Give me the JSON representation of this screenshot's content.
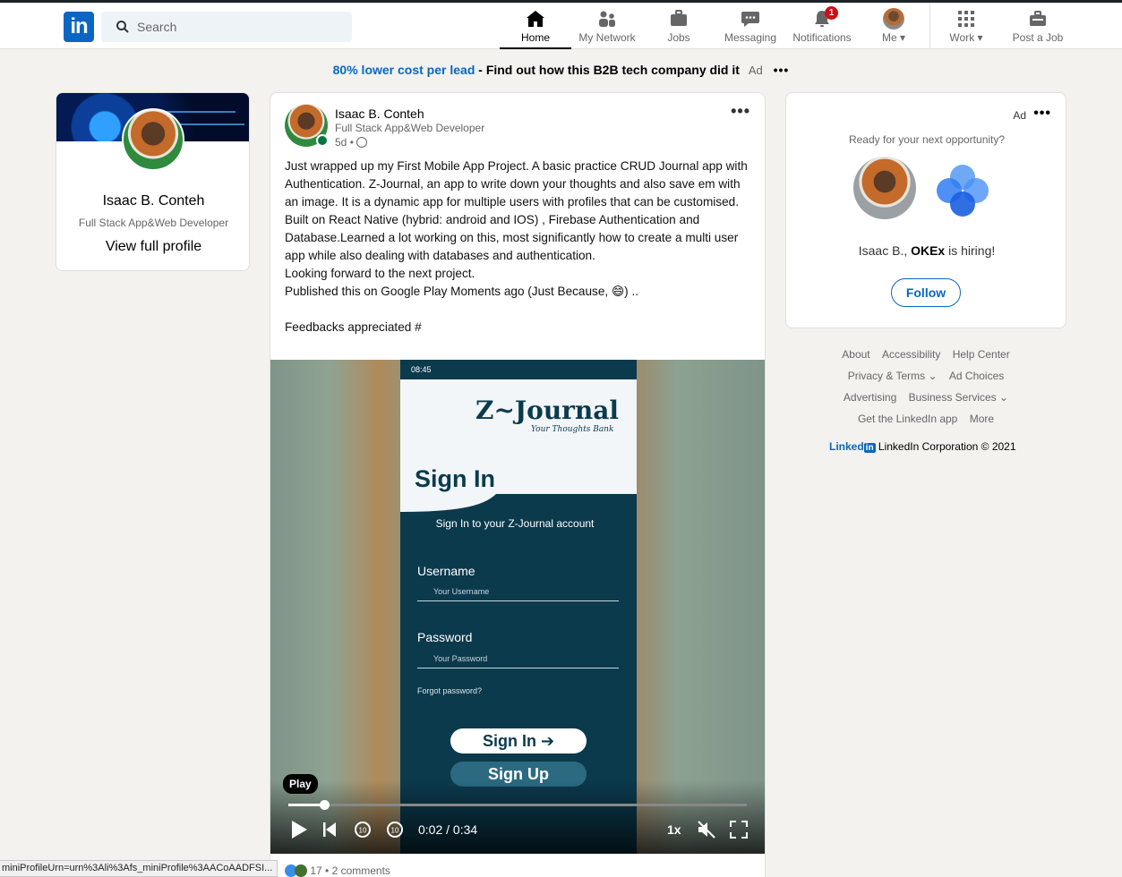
{
  "nav": {
    "search_placeholder": "Search",
    "items": [
      {
        "label": "Home",
        "icon": "home-icon"
      },
      {
        "label": "My Network",
        "icon": "network-icon"
      },
      {
        "label": "Jobs",
        "icon": "briefcase-icon"
      },
      {
        "label": "Messaging",
        "icon": "chat-icon"
      },
      {
        "label": "Notifications",
        "icon": "bell-icon",
        "badge": "1"
      },
      {
        "label": "Me",
        "icon": "avatar"
      },
      {
        "label": "Work",
        "icon": "grid-icon"
      },
      {
        "label": "Post a Job",
        "icon": "post-job-icon"
      }
    ],
    "brand_color": "#0a66c2"
  },
  "ad_banner": {
    "link_text": "80% lower cost per lead",
    "text": " - Find out how this B2B tech company did it",
    "ad_label": "Ad"
  },
  "profile_card": {
    "name": "Isaac B. Conteh",
    "title": "Full Stack App&Web Developer",
    "link": "View full profile"
  },
  "post": {
    "author": "Isaac B. Conteh",
    "author_title": "Full Stack App&Web Developer",
    "age": "5d",
    "body": [
      "Just wrapped up my First Mobile App Project. A basic practice CRUD Journal app with Authentication. Z-Journal, an app to write down your thoughts and also save em with an image. It is a dynamic app for multiple users with profiles that can be customised.",
      "Built on React Native (hybrid: android and IOS) , Firebase Authentication and Database.Learned a lot working on this, most significantly how to create a multi user app while also dealing with databases and authentication.",
      "Looking forward to the next project.",
      "Published this on Google Play Moments ago (Just Because, 😄) ..",
      "",
      "Feedbacks appreciated #"
    ],
    "reactions": "17",
    "comments": "2 comments"
  },
  "video": {
    "status_time": "08:45",
    "app_title": "Z~Journal",
    "app_tagline": "Your Thoughts Bank",
    "signin_heading": "Sign In",
    "signin_sub": "Sign In to your Z-Journal account",
    "username_label": "Username",
    "username_placeholder": "Your Username",
    "password_label": "Password",
    "password_placeholder": "Your Password",
    "forgot": "Forgot password?",
    "signin_button": "Sign In ➔",
    "signup_button": "Sign Up",
    "tooltip": "Play",
    "time": "0:02 / 0:34",
    "speed": "1x",
    "progress_fraction": 0.078
  },
  "ad_card": {
    "ad_label": "Ad",
    "ready": "Ready for your next opportunity?",
    "hiring_name": "Isaac B.,",
    "hiring_company": "OKEx",
    "hiring_suffix": "is hiring!",
    "follow": "Follow"
  },
  "footer": {
    "links": [
      "About",
      "Accessibility",
      "Help Center",
      "Privacy & Terms ⌄",
      "Ad Choices",
      "Advertising",
      "Business Services ⌄",
      "Get the LinkedIn app",
      "More"
    ],
    "brand": "Linked",
    "brand_in": "in",
    "copyright": "LinkedIn Corporation © 2021"
  },
  "statusbar": "miniProfileUrn=urn%3Ali%3Afs_miniProfile%3AACoAADFSI..."
}
